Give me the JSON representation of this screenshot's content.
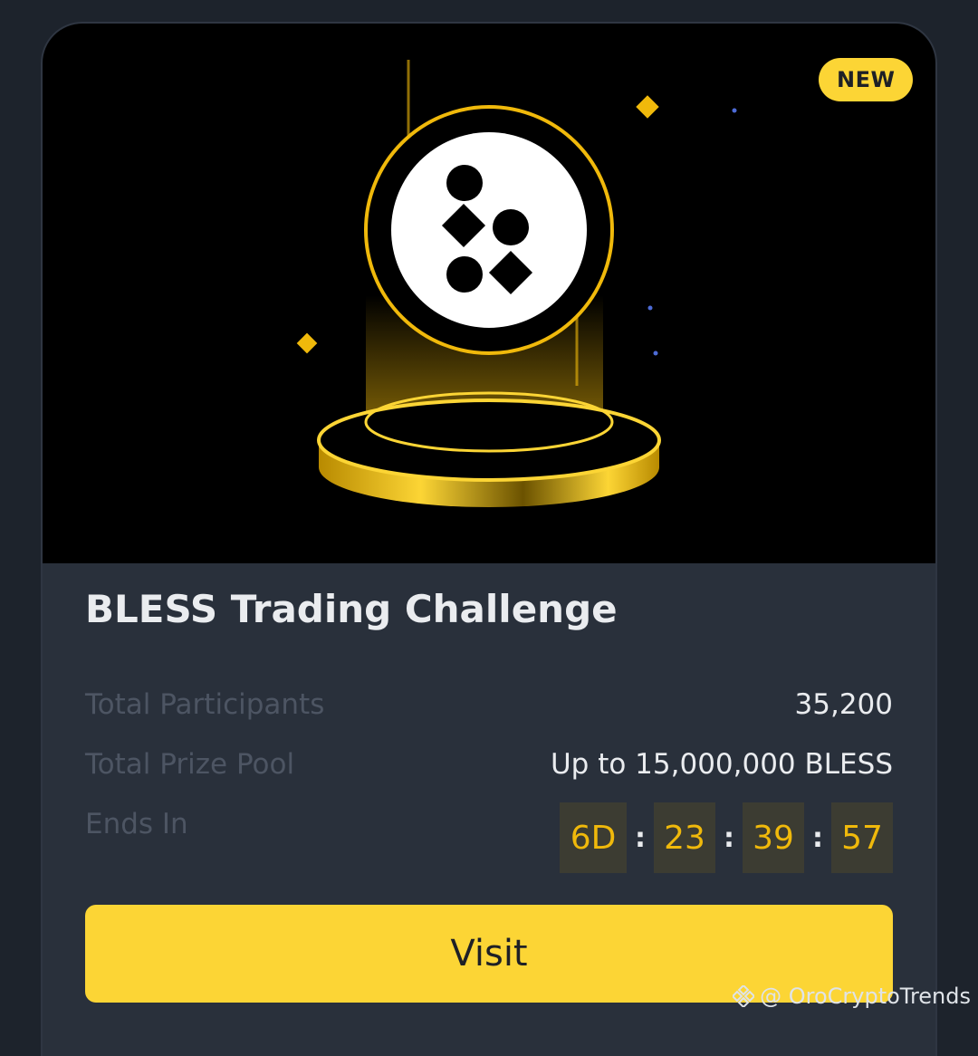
{
  "badge": {
    "label": "NEW"
  },
  "hero": {
    "icon": "bless-coin-icon"
  },
  "challenge": {
    "title": "BLESS Trading Challenge",
    "rows": [
      {
        "label": "Total Participants",
        "value": "35,200"
      },
      {
        "label": "Total Prize Pool",
        "value": "Up to 15,000,000 BLESS"
      },
      {
        "label": "Ends In"
      }
    ],
    "countdown": {
      "days": "6D",
      "hours": "23",
      "minutes": "39",
      "seconds": "57",
      "separator": ":"
    }
  },
  "actions": {
    "visit_label": "Visit"
  },
  "watermark": {
    "text": "@ OroCryptoTrends",
    "icon": "binance-logo-icon"
  },
  "colors": {
    "accent": "#fcd535",
    "card_bg": "#29303b",
    "page_bg": "#1d232c",
    "countdown_text": "#f0b90b"
  }
}
